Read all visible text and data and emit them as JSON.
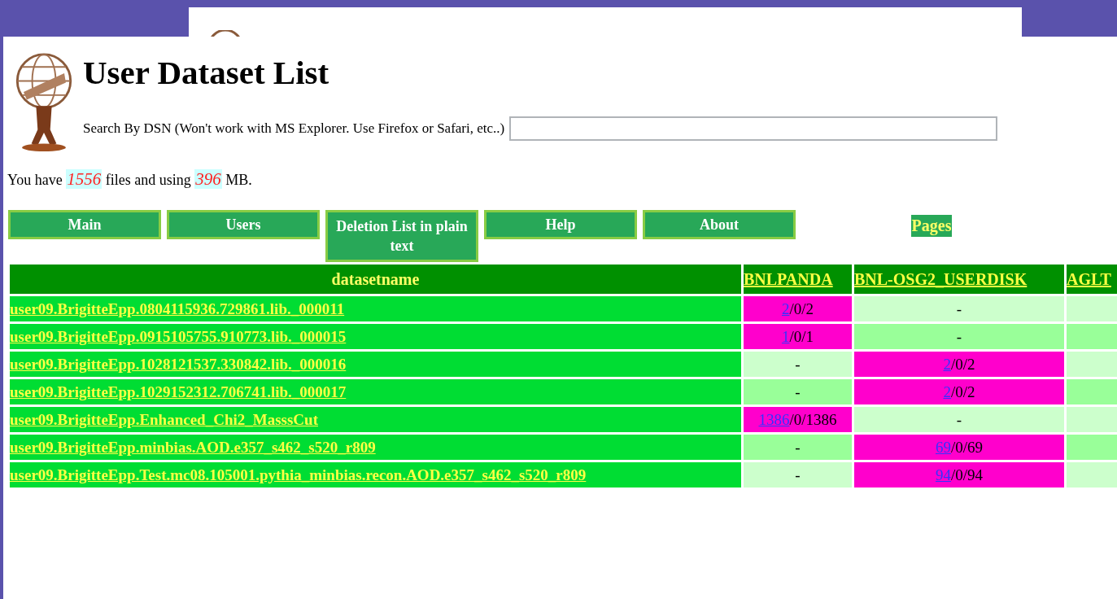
{
  "page": {
    "title": "User Dataset List",
    "search_label": "Search By DSN (Won't work with MS Explorer. Use Firefox or Safari, etc..)",
    "summary": {
      "before": "You have ",
      "files": "1556",
      "middle": " files and using ",
      "size": "396",
      "after": " MB."
    }
  },
  "nav": [
    "Main",
    "Users",
    "Deletion List in plain text",
    "Help",
    "About"
  ],
  "pages_label": "Pages",
  "table": {
    "columns": [
      "datasetname",
      "BNLPANDA",
      "BNL-OSG2_USERDISK",
      "AGLT"
    ],
    "rows": [
      {
        "cells": [
          {
            "kind": "name",
            "text": "user09.BrigitteEpp.0804115936.729861.lib._000011"
          },
          {
            "kind": "count",
            "link": "2",
            "text": "/0/2",
            "highlighted": true
          },
          {
            "kind": "count",
            "text": "-",
            "highlighted": false
          },
          ""
        ]
      },
      {
        "cells": [
          {
            "kind": "name",
            "text": "user09.BrigitteEpp.0915105755.910773.lib._000015"
          },
          {
            "kind": "count",
            "link": "1",
            "text": "/0/1",
            "highlighted": true
          },
          {
            "kind": "count",
            "text": "-",
            "highlighted": false
          },
          ""
        ]
      },
      {
        "cells": [
          {
            "kind": "name",
            "text": "user09.BrigitteEpp.1028121537.330842.lib._000016"
          },
          {
            "kind": "count",
            "text": "-",
            "highlighted": false
          },
          {
            "kind": "count",
            "link": "2",
            "text": "/0/2",
            "highlighted": true
          },
          ""
        ]
      },
      {
        "cells": [
          {
            "kind": "name",
            "text": "user09.BrigitteEpp.1029152312.706741.lib._000017"
          },
          {
            "kind": "count",
            "text": "-",
            "highlighted": false
          },
          {
            "kind": "count",
            "link": "2",
            "text": "/0/2",
            "highlighted": true
          },
          ""
        ]
      },
      {
        "cells": [
          {
            "kind": "name",
            "text": "user09.BrigitteEpp.Enhanced_Chi2_MasssCut"
          },
          {
            "kind": "count",
            "link": "1386",
            "text": "/0/1386",
            "highlighted": true
          },
          {
            "kind": "count",
            "text": "-",
            "highlighted": false
          },
          ""
        ]
      },
      {
        "cells": [
          {
            "kind": "name",
            "text": "user09.BrigitteEpp.minbias.AOD.e357_s462_s520_r809"
          },
          {
            "kind": "count",
            "text": "-",
            "highlighted": false
          },
          {
            "kind": "count",
            "link": "69",
            "text": "/0/69",
            "highlighted": true
          },
          ""
        ]
      },
      {
        "cells": [
          {
            "kind": "name",
            "text": "user09.BrigitteEpp.Test.mc08.105001.pythia_minbias.recon.AOD.e357_s462_s520_r809"
          },
          {
            "kind": "count",
            "text": "-",
            "highlighted": false
          },
          {
            "kind": "count",
            "link": "94",
            "text": "/0/94",
            "highlighted": true
          },
          ""
        ]
      }
    ]
  }
}
